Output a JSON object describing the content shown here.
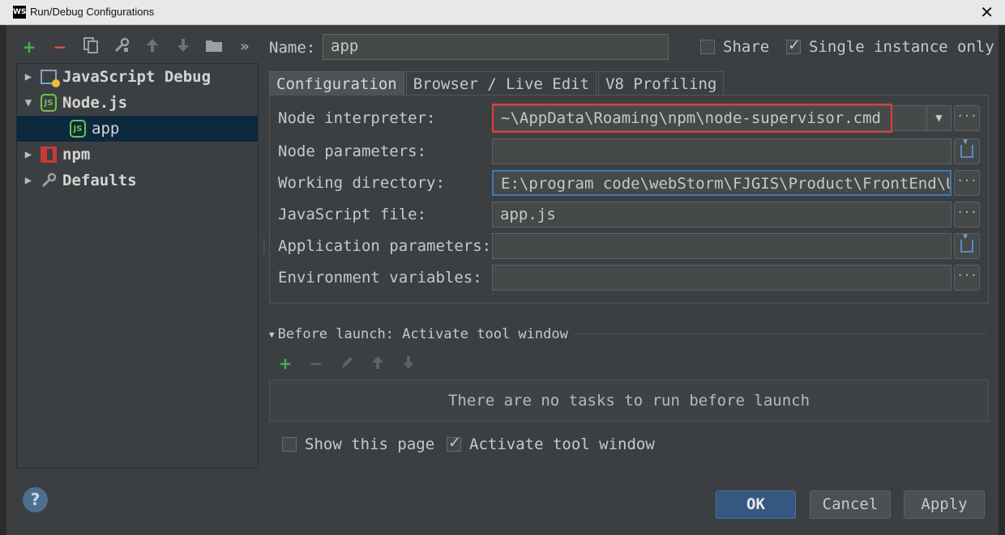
{
  "window": {
    "title": "Run/Debug Configurations",
    "logo_text": "WS",
    "close_glyph": "✕"
  },
  "left_toolbar": {
    "icons": [
      "plus-icon",
      "minus-icon",
      "copy-icon",
      "wrench-icon",
      "arrow-up-icon",
      "arrow-down-icon",
      "folder-icon",
      "more-icon"
    ],
    "more_glyph": "»"
  },
  "tree": {
    "items": [
      {
        "label": "JavaScript Debug",
        "expanded": false,
        "icon": "javascript-debug-icon"
      },
      {
        "label": "Node.js",
        "expanded": true,
        "icon": "nodejs-icon"
      },
      {
        "label": "app",
        "child": true,
        "selected": true,
        "icon": "nodejs-icon"
      },
      {
        "label": "npm",
        "expanded": false,
        "icon": "npm-icon"
      },
      {
        "label": "Defaults",
        "expanded": false,
        "icon": "wrench-icon"
      }
    ]
  },
  "name": {
    "label": "Name:",
    "value": "app"
  },
  "share": {
    "label": "Share",
    "checked": false
  },
  "single_instance": {
    "label": "Single instance only",
    "checked": true
  },
  "tabs": [
    {
      "label": "Configuration",
      "active": true
    },
    {
      "label": "Browser / Live Edit",
      "active": false
    },
    {
      "label": "V8 Profiling",
      "active": false
    }
  ],
  "fields": {
    "node_interpreter": {
      "label": "Node interpreter:",
      "value": "~\\AppData\\Roaming\\npm\\node-supervisor.cmd"
    },
    "node_parameters": {
      "label": "Node parameters:",
      "value": ""
    },
    "working_directory": {
      "label": "Working directory:",
      "value": "E:\\program code\\webStorm\\FJGIS\\Product\\FrontEnd\\UG"
    },
    "javascript_file": {
      "label": "JavaScript file:",
      "value": "app.js"
    },
    "application_parameters": {
      "label": "Application parameters:",
      "value": ""
    },
    "environment_variables": {
      "label": "Environment variables:",
      "value": ""
    }
  },
  "before_launch": {
    "header": "Before launch: Activate tool window",
    "empty_text": "There are no tasks to run before launch"
  },
  "show_this_page": {
    "label": "Show this page",
    "checked": false
  },
  "activate_tool_window": {
    "label": "Activate tool window",
    "checked": true
  },
  "buttons": {
    "help": "?",
    "ok": "OK",
    "cancel": "Cancel",
    "apply": "Apply"
  },
  "colors": {
    "accent": "#365880",
    "highlight_border": "#e33b3b",
    "add_green": "#3fb34f",
    "remove_red": "#d9534f"
  }
}
